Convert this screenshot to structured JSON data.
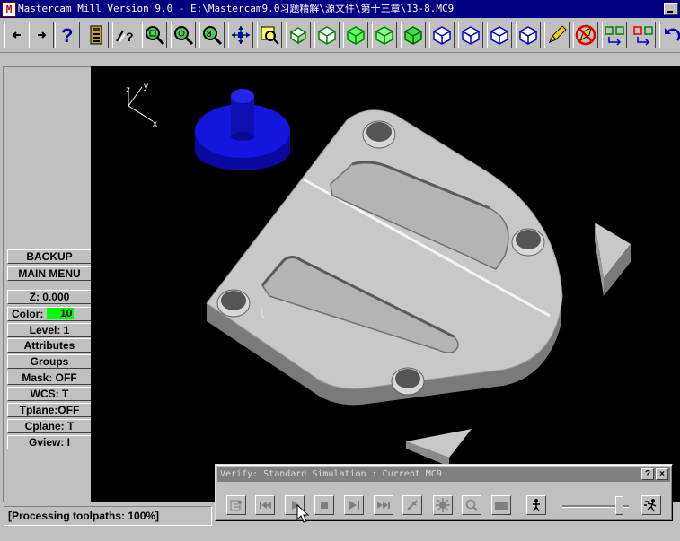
{
  "window": {
    "title": "Mastercam Mill Version 9.0 - E:\\Mastercam9.0习题精解\\源文件\\第十三章\\13-8.MC9",
    "icon_letter": "M"
  },
  "toolbar": {
    "buttons": [
      "back-arrow-icon",
      "forward-arrow-icon",
      "help-icon",
      "calculator-icon",
      "analyze-icon",
      "zoom-window-icon",
      "unzoom-icon",
      "zoom-fit-icon",
      "pan-icon",
      "select-icon",
      "rotate-icon",
      "view-top-icon",
      "view-front-icon",
      "view-side-icon",
      "view-iso-icon",
      "view-cube-1-icon",
      "view-cube-2-icon",
      "view-cube-3-icon",
      "view-cube-4-icon",
      "pencil-icon",
      "no-paint-icon",
      "transform-icon",
      "transform-color-icon",
      "undo-icon"
    ]
  },
  "main_menu": {
    "items": [
      {
        "label": "BACKUP"
      },
      {
        "label": "MAIN MENU"
      },
      {
        "label": "Z:  0.000"
      },
      {
        "label": "Color:",
        "value": "10"
      },
      {
        "label": "Level:  1"
      },
      {
        "label": "Attributes"
      },
      {
        "label": "Groups"
      },
      {
        "label": "Mask:  OFF"
      },
      {
        "label": "WCS:  T"
      },
      {
        "label": "Tplane:OFF"
      },
      {
        "label": "Cplane:  T"
      },
      {
        "label": "Gview:  I"
      }
    ]
  },
  "axes": {
    "z": "z",
    "y": "y",
    "x": "x"
  },
  "status": {
    "text": "[Processing toolpaths:  100%]"
  },
  "verify_dialog": {
    "title": "Verify: Standard Simulation : Current MC9",
    "help_label": "?",
    "close_label": "×",
    "buttons": [
      "options-icon",
      "rewind-icon",
      "play-icon",
      "stop-icon",
      "step-icon",
      "fast-forward-icon",
      "tool-icon",
      "explosion-icon",
      "magnify-icon",
      "folder-icon",
      "person-icon",
      "run-icon"
    ],
    "speed_level_percent": 88
  },
  "colors": {
    "title_bar": "#000080",
    "part_gray": "#c8c8c8",
    "stock_blue": "#1010dd",
    "color_swatch": "#00ff00"
  }
}
